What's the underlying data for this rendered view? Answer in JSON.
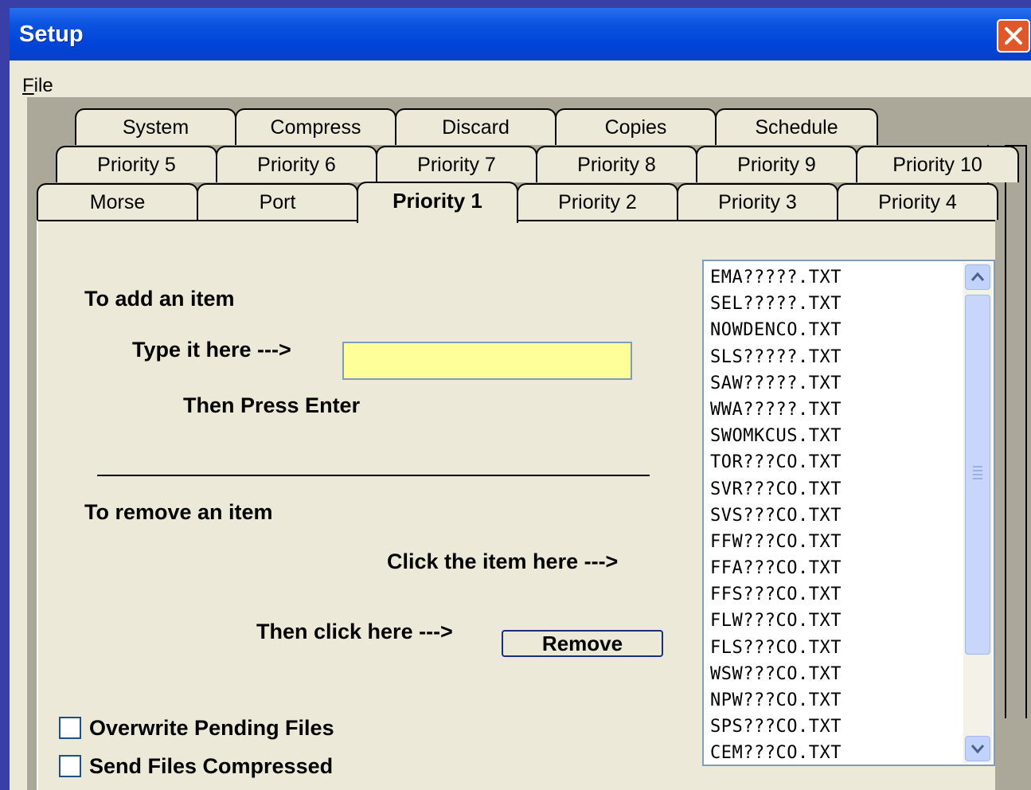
{
  "window": {
    "title": "Setup"
  },
  "menu": {
    "file_label": "File"
  },
  "tabs": {
    "row_top": [
      "System",
      "Compress",
      "Discard",
      "Copies",
      "Schedule"
    ],
    "row_mid": [
      "Priority 5",
      "Priority 6",
      "Priority 7",
      "Priority 8",
      "Priority 9",
      "Priority 10"
    ],
    "row_front": [
      "Morse",
      "Port",
      "Priority 1",
      "Priority 2",
      "Priority 3",
      "Priority 4"
    ],
    "active": "Priority 1"
  },
  "panel": {
    "add_heading": "To add an item",
    "type_label": "Type it here --->",
    "entry_value": "",
    "press_enter": "Then Press Enter",
    "remove_heading": "To remove an item",
    "click_item_label": "Click the item here --->",
    "then_click_label": "Then click here --->",
    "remove_button": "Remove",
    "overwrite_label": "Overwrite Pending Files",
    "overwrite_checked": false,
    "compressed_label": "Send Files Compressed",
    "compressed_checked": false
  },
  "file_list": [
    "EMA?????.TXT",
    "SEL?????.TXT",
    "NOWDENCO.TXT",
    "SLS?????.TXT",
    "SAW?????.TXT",
    "WWA?????.TXT",
    "SWOMKCUS.TXT",
    "TOR???CO.TXT",
    "SVR???CO.TXT",
    "SVS???CO.TXT",
    "FFW???CO.TXT",
    "FFA???CO.TXT",
    "FFS???CO.TXT",
    "FLW???CO.TXT",
    "FLS???CO.TXT",
    "WSW???CO.TXT",
    "NPW???CO.TXT",
    "SPS???CO.TXT",
    "CEM???CO.TXT"
  ],
  "colors": {
    "titlebar": "#0a4fd8",
    "entry_background": "#ffff99",
    "dialog_face": "#ece9d8"
  }
}
